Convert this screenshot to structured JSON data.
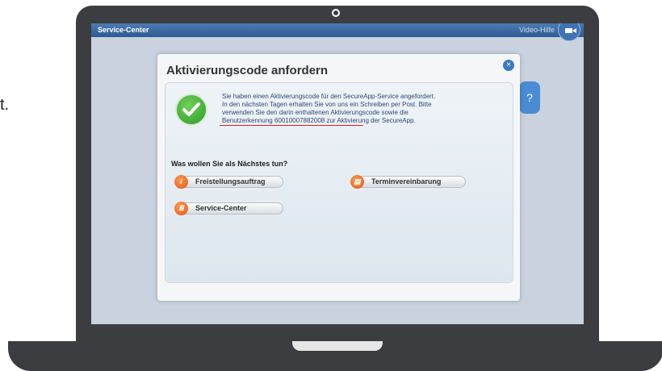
{
  "stray_text": "t.",
  "topbar": {
    "app_title": "Service-Center",
    "video_help": "Video-Hilfe"
  },
  "help_tab": {
    "label": "?"
  },
  "dialog": {
    "title": "Aktivierungscode anfordern",
    "close_icon": "×",
    "message_lines": [
      "Sie haben einen Aktivierungscode für den SecureApp-Service angefordert.",
      "In den nächsten Tagen erhalten Sie von uns ein Schreiben per Post. Bitte",
      "verwenden Sie den darin enthaltenen Aktivierungscode sowie die",
      "Benutzerkennung 60010007882008 zur Aktivierung der SecureApp."
    ],
    "question": "Was wollen Sie als Nächstes tun?",
    "buttons": {
      "freistellung": "Freistellungsauftrag",
      "termin": "Terminvereinbarung",
      "service": "Service-Center"
    }
  },
  "colors": {
    "accent": "#3d78c0",
    "button_icon": "#e2561a",
    "underline": "#d62020"
  }
}
